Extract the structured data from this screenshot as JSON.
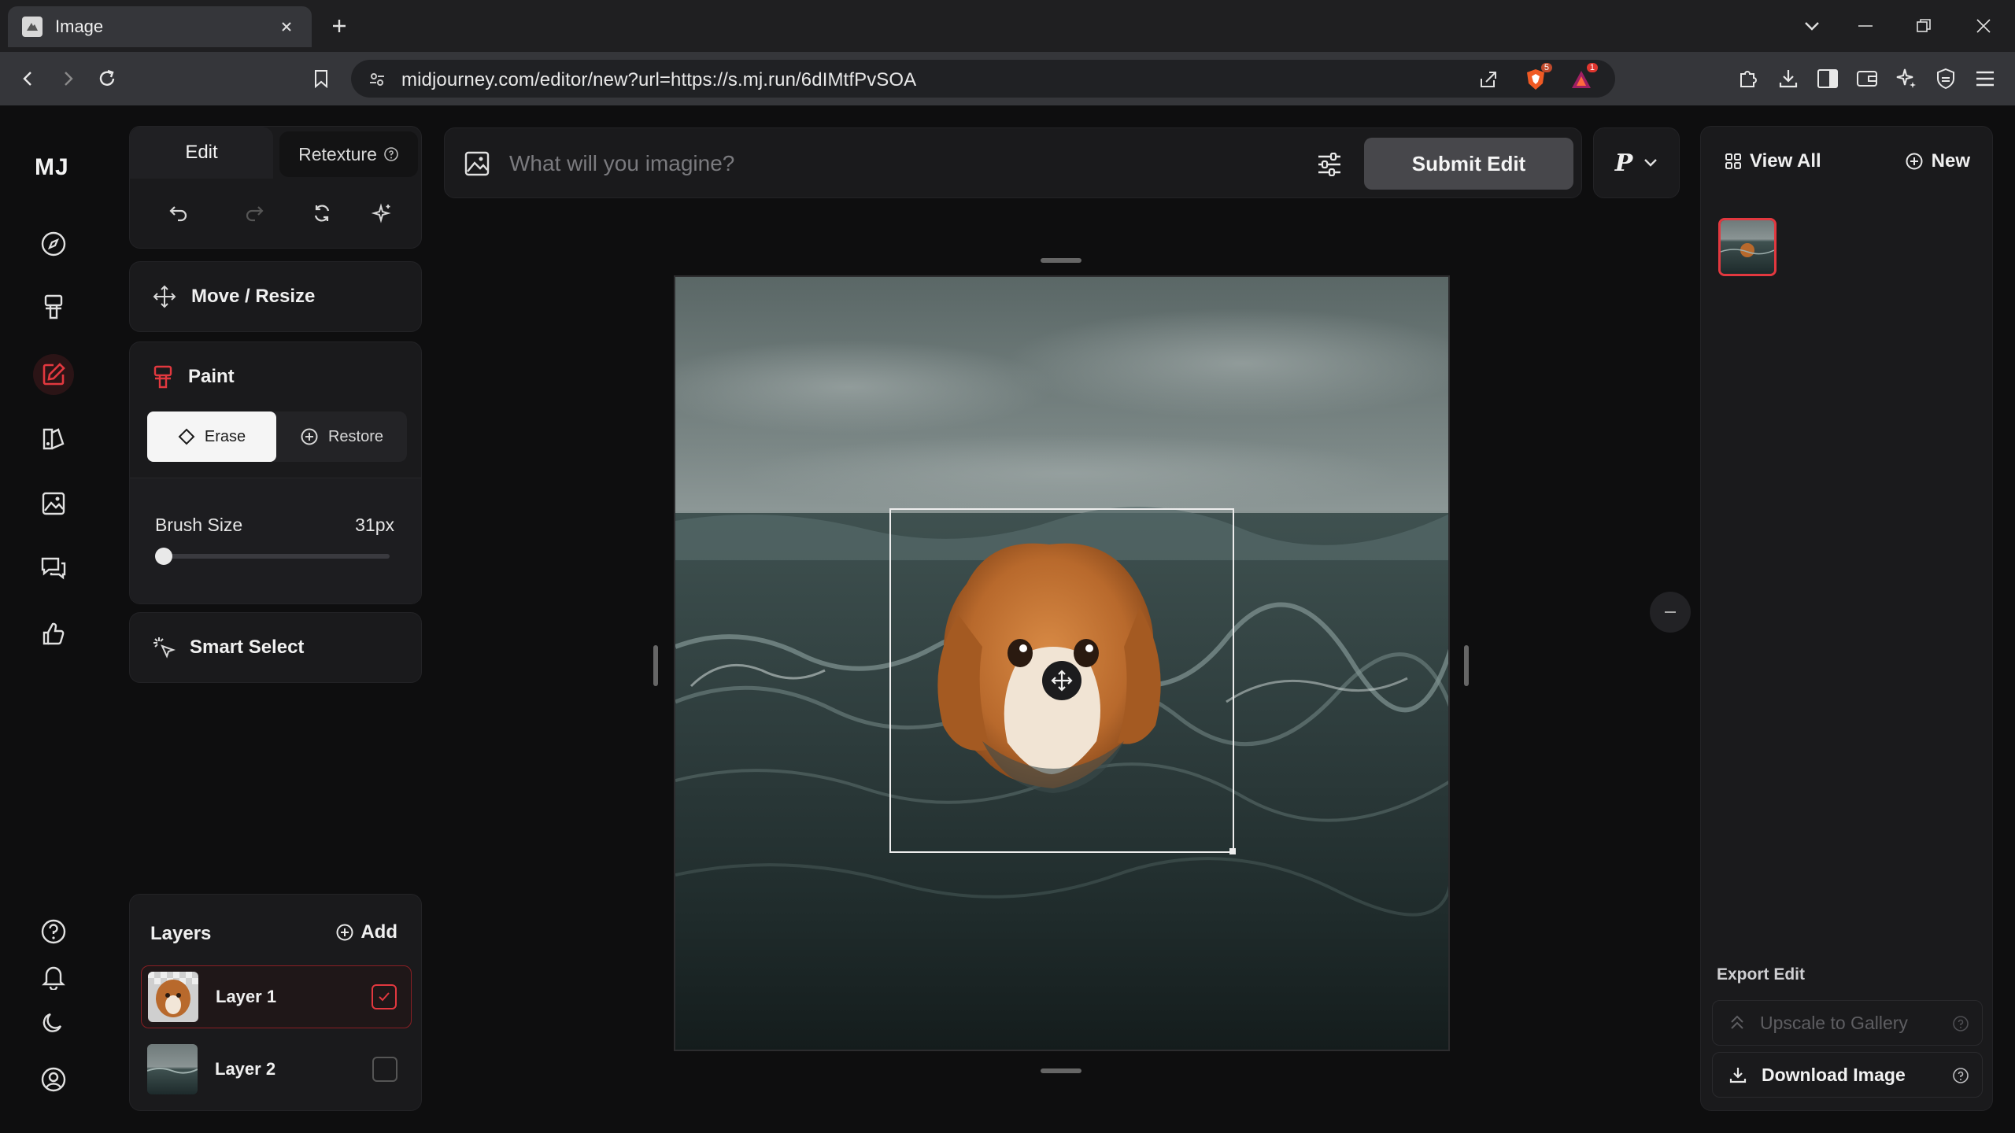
{
  "browser": {
    "tab_title": "Image",
    "url": "midjourney.com/editor/new?url=https://s.mj.run/6dIMtfPvSOA",
    "brave_count": "5",
    "alert_count": "1"
  },
  "app": {
    "logo": "MJ",
    "tabs": {
      "edit": "Edit",
      "retexture": "Retexture"
    },
    "tools": {
      "move_resize": "Move / Resize",
      "paint": "Paint",
      "erase": "Erase",
      "restore": "Restore",
      "brush_size_label": "Brush Size",
      "brush_size_value": "31px",
      "brush_level": 0.0,
      "smart_select": "Smart Select"
    },
    "prompt": {
      "placeholder": "What will you imagine?",
      "submit": "Submit Edit",
      "mode": "P"
    },
    "layers": {
      "title": "Layers",
      "add": "Add",
      "items": [
        {
          "name": "Layer 1",
          "checked": true
        },
        {
          "name": "Layer 2",
          "checked": false
        }
      ]
    },
    "right": {
      "view_all": "View All",
      "new": "New",
      "export_label": "Export Edit",
      "upscale": "Upscale to Gallery",
      "download": "Download Image"
    }
  },
  "colors": {
    "accent": "#e2383f",
    "background": "#0e0e0f",
    "panel": "#1a1a1c"
  }
}
